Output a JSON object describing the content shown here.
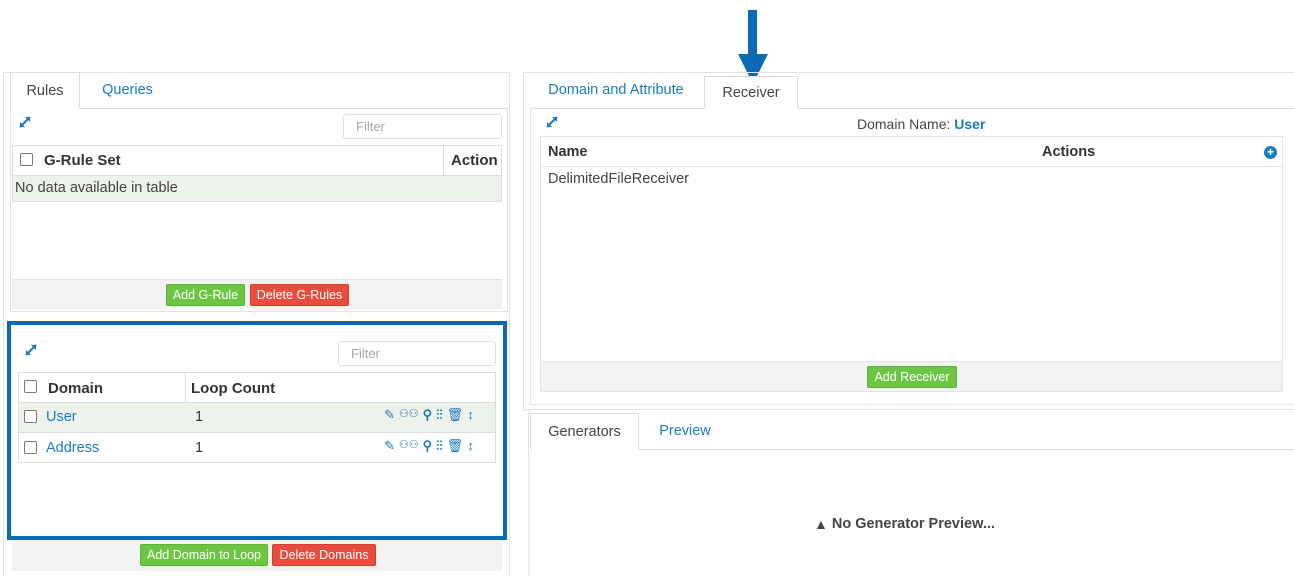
{
  "left_panel": {
    "tabs": [
      {
        "label": "Rules",
        "active": true
      },
      {
        "label": "Queries",
        "active": false
      }
    ],
    "rules_table": {
      "filter_placeholder": "Filter",
      "columns": [
        "G-Rule Set",
        "Action"
      ],
      "empty_text": "No data available in table",
      "buttons": {
        "add": "Add G-Rule",
        "delete": "Delete G-Rules"
      }
    },
    "domain_table": {
      "filter_placeholder": "Filter",
      "columns": [
        "Domain",
        "Loop Count"
      ],
      "rows": [
        {
          "domain": "User",
          "loop_count": "1"
        },
        {
          "domain": "Address",
          "loop_count": "1"
        }
      ],
      "buttons": {
        "add": "Add Domain to Loop",
        "delete": "Delete Domains"
      }
    }
  },
  "right_panel": {
    "tabs": [
      {
        "label": "Domain and Attribute",
        "active": false
      },
      {
        "label": "Receiver",
        "active": true
      }
    ],
    "domain_name_label": "Domain Name:",
    "domain_name_value": "User",
    "receiver_table": {
      "columns": [
        "Name",
        "Actions"
      ],
      "rows": [
        {
          "name": "DelimitedFileReceiver"
        }
      ],
      "add_button": "Add Receiver"
    },
    "generator_tabs": [
      {
        "label": "Generators",
        "active": true
      },
      {
        "label": "Preview",
        "active": false
      }
    ],
    "generator_message": "No Generator Preview..."
  },
  "colors": {
    "link": "#1a7bbf",
    "highlight_border": "#0a6ab4",
    "arrow": "#0a6ab4",
    "button_green": "#6cc644",
    "button_red": "#e74c3c",
    "row_stripe": "#edf3ea"
  }
}
